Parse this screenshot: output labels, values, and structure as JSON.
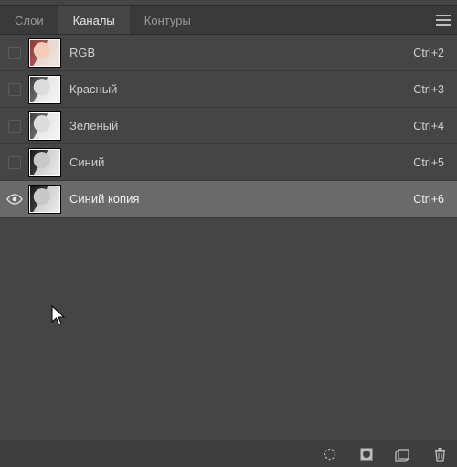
{
  "tabs": {
    "layers": "Слои",
    "channels": "Каналы",
    "paths": "Контуры"
  },
  "channels": [
    {
      "name": "RGB",
      "shortcut": "Ctrl+2",
      "visible": false,
      "selected": false,
      "kind": "rgb"
    },
    {
      "name": "Красный",
      "shortcut": "Ctrl+3",
      "visible": false,
      "selected": false,
      "kind": "gray"
    },
    {
      "name": "Зеленый",
      "shortcut": "Ctrl+4",
      "visible": false,
      "selected": false,
      "kind": "gray"
    },
    {
      "name": "Синий",
      "shortcut": "Ctrl+5",
      "visible": false,
      "selected": false,
      "kind": "gray dark"
    },
    {
      "name": "Синий копия",
      "shortcut": "Ctrl+6",
      "visible": true,
      "selected": true,
      "kind": "gray dark"
    }
  ],
  "icons": {
    "panel_menu": "panel-menu-icon",
    "load_selection": "load-selection-icon",
    "mask": "save-selection-mask-icon",
    "new_channel": "new-channel-icon",
    "delete": "delete-icon"
  }
}
